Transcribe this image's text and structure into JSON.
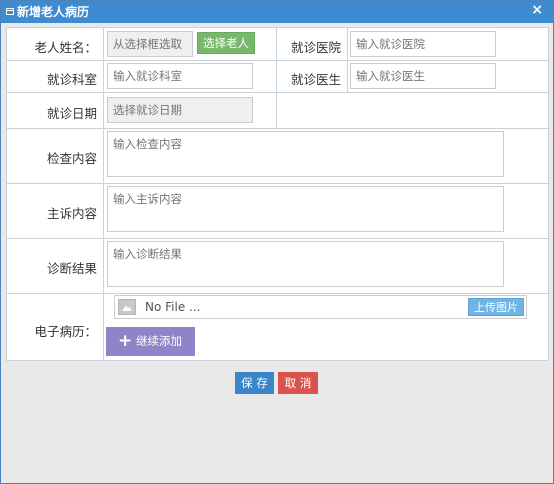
{
  "dialog": {
    "title": "新增老人病历",
    "close_glyph": "×"
  },
  "form": {
    "elder_name": {
      "label": "老人姓名：",
      "placeholder": "从选择框选取",
      "button": "选择老人"
    },
    "hospital": {
      "label": "就诊医院",
      "placeholder": "输入就诊医院"
    },
    "department": {
      "label": "就诊科室",
      "placeholder": "输入就诊科室"
    },
    "doctor": {
      "label": "就诊医生",
      "placeholder": "输入就诊医生"
    },
    "visit_date": {
      "label": "就诊日期",
      "placeholder": "选择就诊日期"
    },
    "exam": {
      "label": "检查内容",
      "placeholder": "输入检查内容"
    },
    "complaint": {
      "label": "主诉内容",
      "placeholder": "输入主诉内容"
    },
    "diagnosis": {
      "label": "诊断结果",
      "placeholder": "输入诊断结果"
    },
    "record": {
      "label": "电子病历：",
      "file_text": "No File ...",
      "upload_button": "上传图片",
      "add_more_button": "继续添加",
      "add_icon": "plus-icon"
    }
  },
  "footer": {
    "save": "保 存",
    "cancel": "取 消"
  },
  "colors": {
    "titlebar": "#3f8bd1",
    "green": "#78b86b",
    "blue": "#3b85c9",
    "red": "#d9544f",
    "purple": "#8e85c9"
  }
}
